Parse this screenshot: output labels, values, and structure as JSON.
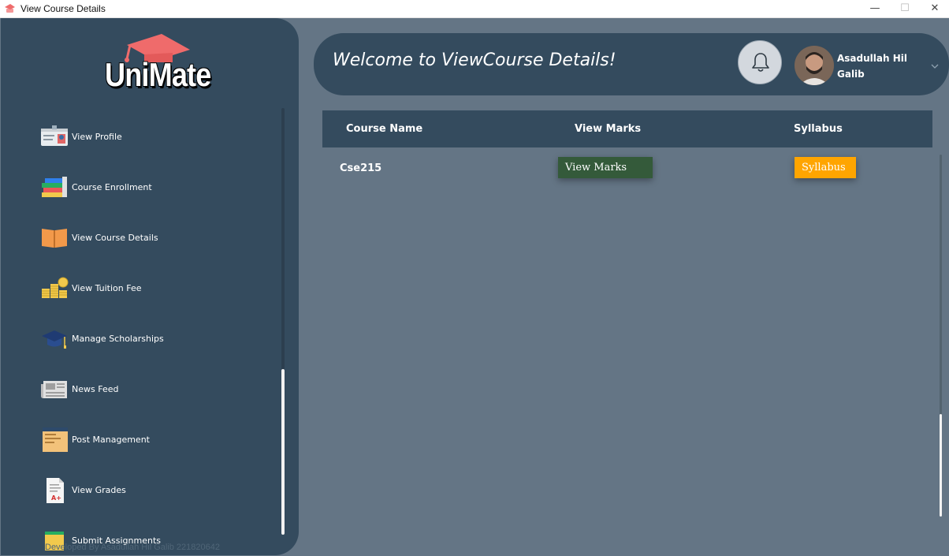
{
  "window": {
    "title": "View Course Details",
    "controls": {
      "minimize": "—",
      "maximize": "☐",
      "close": "✕"
    }
  },
  "sidebar": {
    "logo_text": "UniMate",
    "items": [
      {
        "label": "View Profile",
        "icon": "id-card-icon"
      },
      {
        "label": "Course Enrollment",
        "icon": "books-stack-icon"
      },
      {
        "label": "View Course Details",
        "icon": "open-book-icon"
      },
      {
        "label": "View Tuition Fee",
        "icon": "coin-stacks-icon"
      },
      {
        "label": "Manage Scholarships",
        "icon": "graduation-cap-icon"
      },
      {
        "label": "News Feed",
        "icon": "newspaper-icon"
      },
      {
        "label": "Post Management",
        "icon": "post-board-icon"
      },
      {
        "label": "View Grades",
        "icon": "grade-sheet-icon"
      },
      {
        "label": "Submit Assignments",
        "icon": "assignment-icon"
      }
    ],
    "footer": "Developed By Asadullah Hil Galib 221820642"
  },
  "header": {
    "welcome": "Welcome to ViewCourse Details!",
    "user_name": "Asadullah Hil Galib",
    "bell_icon": "bell-icon"
  },
  "table": {
    "columns": [
      "Course Name",
      "View Marks",
      "Syllabus"
    ],
    "rows": [
      {
        "course": "Cse215",
        "marks_button": "View Marks",
        "syllabus_button": "Syllabus"
      }
    ]
  },
  "colors": {
    "sidebar_bg": "#344b5e",
    "content_bg": "#647585",
    "view_marks_button": "#345a3a",
    "syllabus_button": "#ffa500",
    "logo_cap": "#ef6b6b"
  }
}
